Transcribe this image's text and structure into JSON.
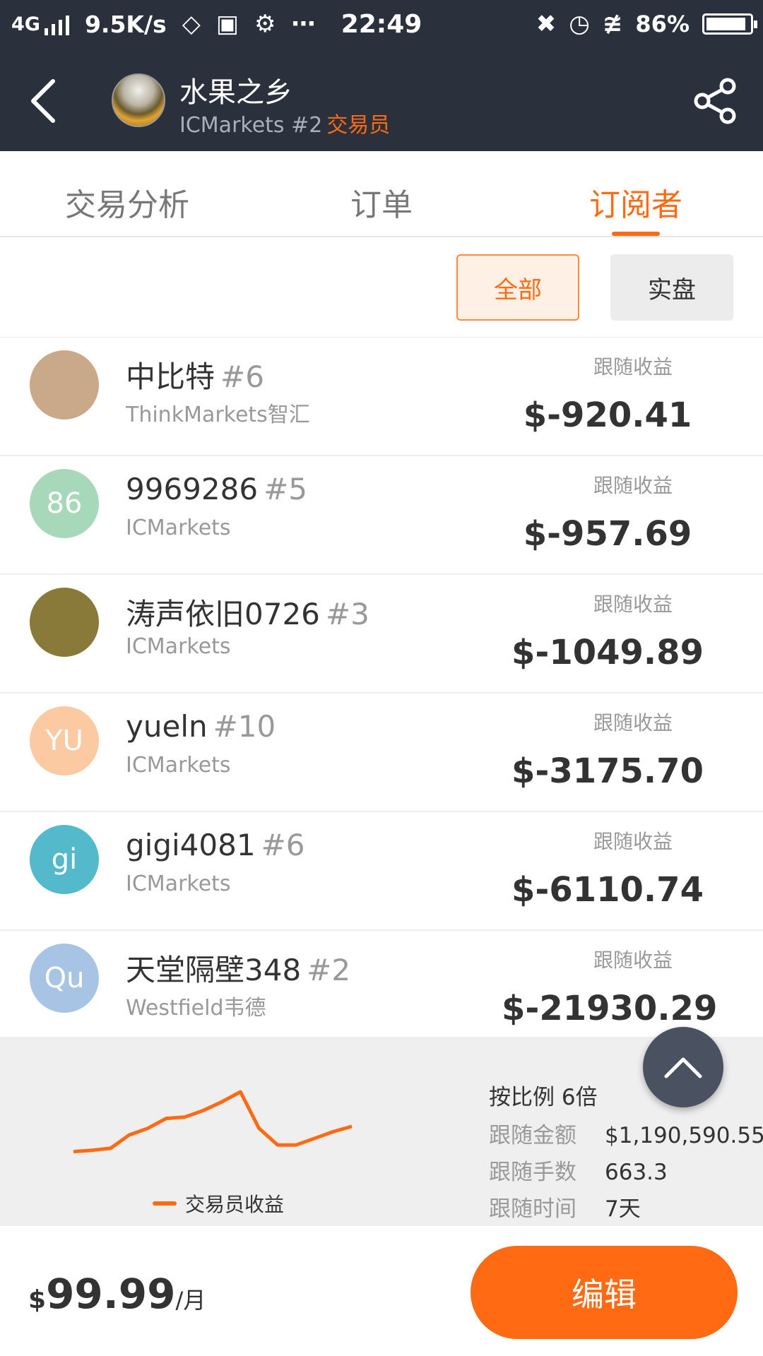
{
  "status_bar": {
    "network": "4G",
    "speed": "9.5K/s",
    "time": "22:49",
    "battery": "86%"
  },
  "header": {
    "title": "水果之乡",
    "broker": "ICMarkets #2",
    "role": "交易员"
  },
  "tabs": [
    {
      "label": "交易分析",
      "active": false
    },
    {
      "label": "订单",
      "active": false
    },
    {
      "label": "订阅者",
      "active": true
    }
  ],
  "filters": {
    "all_label": "全部",
    "real_label": "实盘",
    "selected": "全部"
  },
  "subscribers": [
    {
      "name": "中比特",
      "rank": "#6",
      "broker": "ThinkMarkets智汇",
      "profit_label": "跟随收益",
      "profit": "$-920.41",
      "avatar_text": "",
      "avatar_color": "#c9a98a"
    },
    {
      "name": "9969286",
      "rank": "#5",
      "broker": "ICMarkets",
      "profit_label": "跟随收益",
      "profit": "$-957.69",
      "avatar_text": "86",
      "avatar_color": "#a6d8b9"
    },
    {
      "name": "涛声依旧0726",
      "rank": "#3",
      "broker": "ICMarkets",
      "profit_label": "跟随收益",
      "profit": "$-1049.89",
      "avatar_text": "",
      "avatar_color": "#8a7a3a"
    },
    {
      "name": "yueln",
      "rank": "#10",
      "broker": "ICMarkets",
      "profit_label": "跟随收益",
      "profit": "$-3175.70",
      "avatar_text": "YU",
      "avatar_color": "#fbc9a2"
    },
    {
      "name": "gigi4081",
      "rank": "#6",
      "broker": "ICMarkets",
      "profit_label": "跟随收益",
      "profit": "$-6110.74",
      "avatar_text": "gi",
      "avatar_color": "#54b9ca"
    },
    {
      "name": "天堂隔壁348",
      "rank": "#2",
      "broker": "Westfield韦德",
      "profit_label": "跟随收益",
      "profit": "$-21930.29",
      "avatar_text": "Qu",
      "avatar_color": "#a7c4e4"
    }
  ],
  "summary": {
    "legend": "交易员收益",
    "ratio": "按比例 6倍",
    "rows": [
      {
        "key": "跟随金额",
        "value": "$1,190,590.55"
      },
      {
        "key": "跟随手数",
        "value": "663.3"
      },
      {
        "key": "跟随时间",
        "value": "7天"
      }
    ],
    "trend": [
      0.1,
      0.12,
      0.15,
      0.35,
      0.45,
      0.6,
      0.62,
      0.72,
      0.85,
      1.0,
      0.45,
      0.2,
      0.2,
      0.3,
      0.4,
      0.48
    ]
  },
  "bottom": {
    "currency": "$",
    "price": "99.99",
    "unit": "/月",
    "edit_label": "编辑"
  },
  "colors": {
    "accent": "#ff6a13",
    "header_bg": "#2b313c"
  }
}
